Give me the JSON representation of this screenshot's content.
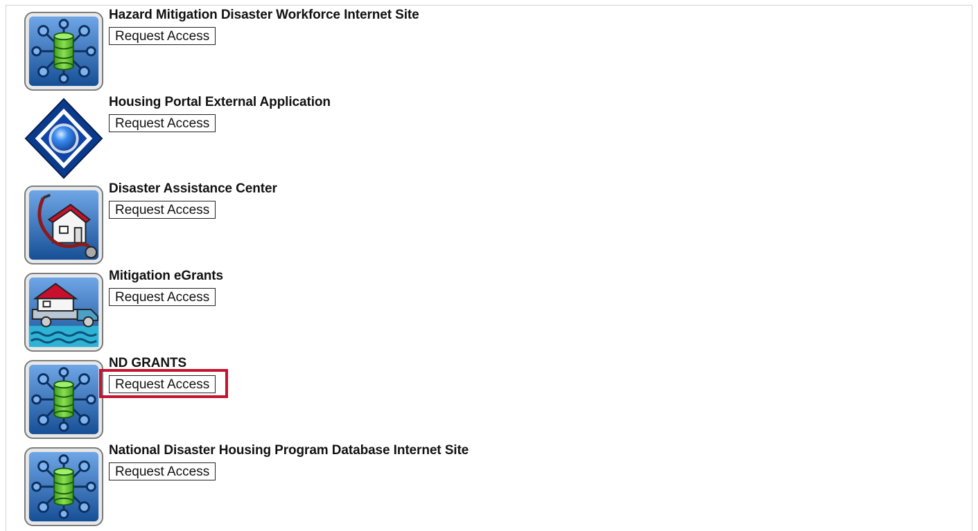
{
  "apps": [
    {
      "title": "Hazard Mitigation Disaster Workforce Internet Site",
      "button_label": "Request Access",
      "icon": "database-network-icon"
    },
    {
      "title": "Housing Portal External Application",
      "button_label": "Request Access",
      "icon": "blue-diamond-icon"
    },
    {
      "title": "Disaster Assistance Center",
      "button_label": "Request Access",
      "icon": "house-stethoscope-icon"
    },
    {
      "title": "Mitigation eGrants",
      "button_label": "Request Access",
      "icon": "house-truck-flood-icon"
    },
    {
      "title": "ND GRANTS",
      "button_label": "Request Access",
      "icon": "database-network-icon",
      "highlighted": true
    },
    {
      "title": "National Disaster Housing Program Database Internet Site",
      "button_label": "Request Access",
      "icon": "database-network-icon"
    }
  ],
  "colors": {
    "icon_blue": "#1f5fa8",
    "db_green": "#5bc23b",
    "highlight_red": "#c4122f"
  }
}
